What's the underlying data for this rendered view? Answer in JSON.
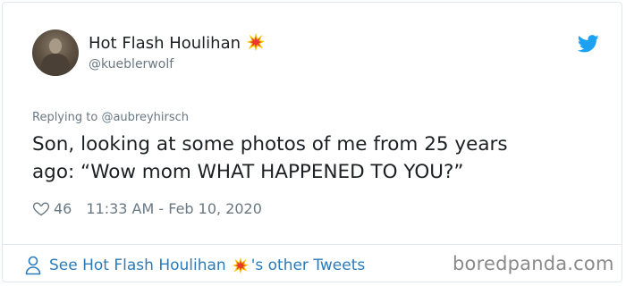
{
  "tweet": {
    "author_name": "Hot Flash Houlihan",
    "author_emoji": "collision-burst-emoji",
    "author_handle": "@kueblerwolf",
    "replying_prefix": "Replying to",
    "replying_to": "@aubreyhirsch",
    "text_line1": "Son, looking at some photos of me from 25 years",
    "text_line2": "ago: “Wow mom WHAT HAPPENED TO YOU?”",
    "like_count": "46",
    "timestamp": "11:33 AM - Feb 10, 2020"
  },
  "footer": {
    "see_prefix": "See Hot Flash Houlihan",
    "see_suffix": "'s other Tweets"
  },
  "watermark": "boredpanda.com",
  "icons": {
    "brand": "twitter-bird-icon",
    "like": "heart-icon",
    "profile": "person-icon"
  },
  "colors": {
    "link_blue": "#2b7bb9",
    "twitter_blue": "#1da1f2",
    "secondary_text": "#697882",
    "primary_text": "#1c2022",
    "border": "#e1e8ed"
  }
}
